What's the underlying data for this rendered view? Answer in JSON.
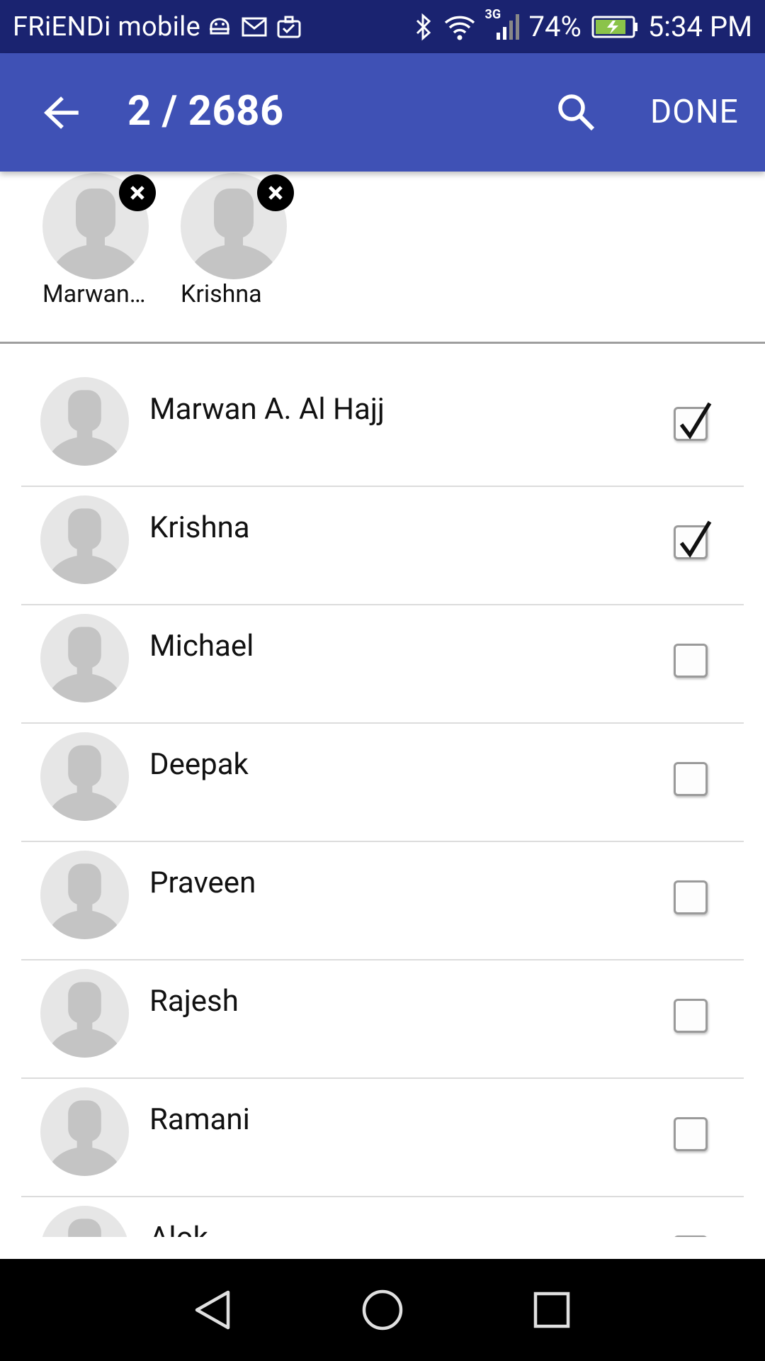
{
  "status_bar": {
    "carrier": "FRiENDi mobile",
    "network_type": "3G",
    "battery_percent": "74%",
    "time": "5:34 PM",
    "icons_left": [
      "android-debug-icon",
      "gmail-icon",
      "briefcase-icon"
    ],
    "icons_right": [
      "bluetooth-icon",
      "wifi-icon",
      "signal-icon",
      "battery-charging-icon"
    ]
  },
  "app_bar": {
    "title": "2 / 2686",
    "done_label": "DONE",
    "color": "#3f51b5"
  },
  "selected": [
    {
      "name": "Marwan…"
    },
    {
      "name": "Krishna"
    }
  ],
  "contacts": [
    {
      "name": "Marwan A. Al Hajj",
      "checked": true
    },
    {
      "name": "Krishna",
      "checked": true
    },
    {
      "name": "Michael",
      "checked": false
    },
    {
      "name": "Deepak",
      "checked": false
    },
    {
      "name": "Praveen",
      "checked": false
    },
    {
      "name": "Rajesh",
      "checked": false
    },
    {
      "name": "Ramani",
      "checked": false
    },
    {
      "name": "Alok",
      "checked": false
    }
  ],
  "nav_bar": {
    "buttons": [
      "back-icon",
      "home-icon",
      "recents-icon"
    ]
  }
}
